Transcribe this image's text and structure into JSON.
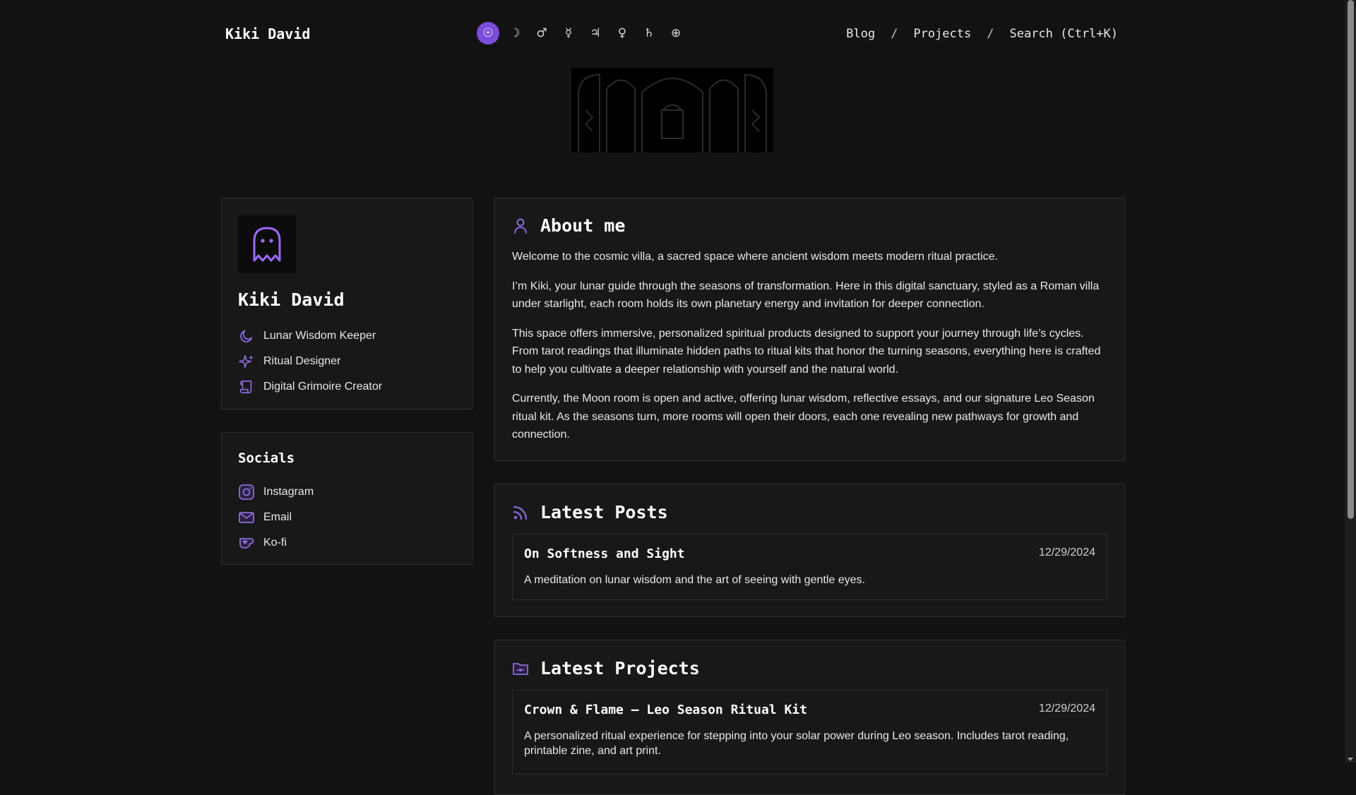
{
  "header": {
    "site_title": "Kiki David",
    "planets": [
      "☉",
      "☽",
      "♂",
      "☿",
      "♃",
      "♀",
      "♄",
      "⊕"
    ],
    "nav": {
      "blog": "Blog",
      "sep1": "/",
      "projects": "Projects",
      "sep2": "/",
      "search": "Search (Ctrl+K)"
    }
  },
  "profile": {
    "name": "Kiki David",
    "roles": [
      {
        "label": "Lunar Wisdom Keeper",
        "icon": "moon-icon"
      },
      {
        "label": "Ritual Designer",
        "icon": "sparkles-icon"
      },
      {
        "label": "Digital Grimoire Creator",
        "icon": "scroll-icon"
      }
    ]
  },
  "socials": {
    "title": "Socials",
    "items": [
      {
        "label": "Instagram",
        "icon": "instagram-icon"
      },
      {
        "label": "Email",
        "icon": "mail-icon"
      },
      {
        "label": "Ko-fi",
        "icon": "kofi-icon"
      }
    ]
  },
  "about": {
    "title": "About me",
    "paragraphs": [
      "Welcome to the cosmic villa, a sacred space where ancient wisdom meets modern ritual practice.",
      "I’m Kiki, your lunar guide through the seasons of transformation. Here in this digital sanctuary, styled as a Roman villa under starlight, each room holds its own planetary energy and invitation for deeper connection.",
      "This space offers immersive, personalized spiritual products designed to support your journey through life’s cycles. From tarot readings that illuminate hidden paths to ritual kits that honor the turning seasons, everything here is crafted to help you cultivate a deeper relationship with yourself and the natural world.",
      "Currently, the Moon room is open and active, offering lunar wisdom, reflective essays, and our signature Leo Season ritual kit. As the seasons turn, more rooms will open their doors, each one revealing new pathways for growth and connection."
    ]
  },
  "latest_posts": {
    "title": "Latest Posts",
    "items": [
      {
        "title": "On Softness and Sight",
        "date": "12/29/2024",
        "description": "A meditation on lunar wisdom and the art of seeing with gentle eyes."
      }
    ]
  },
  "latest_projects": {
    "title": "Latest Projects",
    "items": [
      {
        "title": "Crown & Flame – Leo Season Ritual Kit",
        "date": "12/29/2024",
        "description": "A personalized ritual experience for stepping into your solar power during Leo season. Includes tarot reading, printable zine, and art print."
      }
    ]
  },
  "colors": {
    "accent": "#7c4ddb",
    "background": "#121212",
    "card": "#181818",
    "border": "#2e2e2e"
  }
}
